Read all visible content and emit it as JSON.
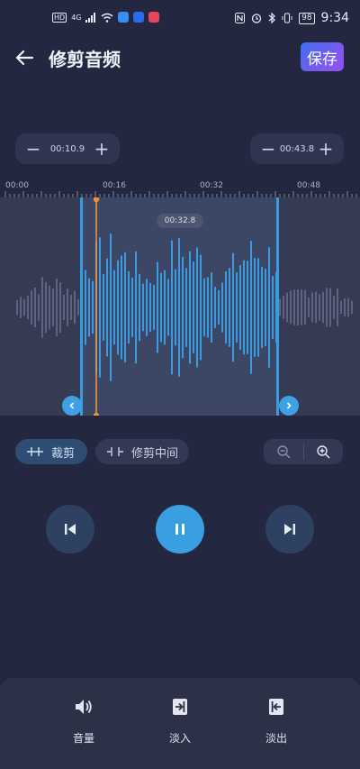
{
  "status_bar": {
    "left_badges": [
      "HD",
      "4G"
    ],
    "battery": "98",
    "time": "9:34",
    "app_icon_colors": [
      "#3a8df5",
      "#2a6be8",
      "#e8455a"
    ]
  },
  "header": {
    "title": "修剪音频",
    "save_label": "保存"
  },
  "start_stepper": {
    "minus": "−",
    "value": "00:10.9",
    "plus": "+"
  },
  "end_stepper": {
    "minus": "−",
    "value": "00:43.8",
    "plus": "+"
  },
  "timeline": {
    "labels": [
      "00:00",
      "00:16",
      "00:32",
      "00:48"
    ]
  },
  "waveform": {
    "playhead_time": "00:32.8",
    "selection_color": "#3b9be0",
    "playhead_color": "#f0903a"
  },
  "mode_chips": {
    "trim": "裁剪",
    "trim_middle": "修剪中间"
  },
  "zoom": {
    "out_icon": "zoom-out-icon",
    "in_icon": "zoom-in-icon"
  },
  "playback": {
    "prev_icon": "skip-previous-icon",
    "pause_icon": "pause-icon",
    "next_icon": "skip-next-icon"
  },
  "tools": [
    {
      "label": "音量",
      "icon": "volume-icon"
    },
    {
      "label": "淡入",
      "icon": "fade-in-icon"
    },
    {
      "label": "淡出",
      "icon": "fade-out-icon"
    }
  ]
}
